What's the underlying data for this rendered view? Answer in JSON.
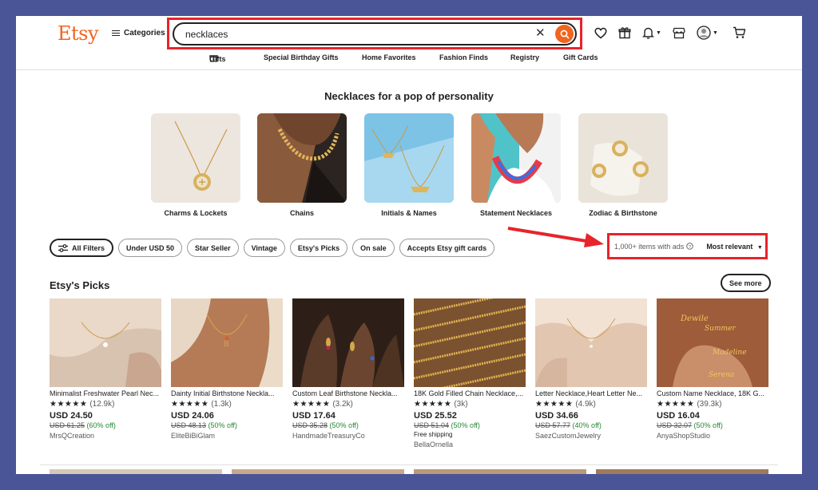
{
  "header": {
    "logo": "Etsy",
    "categories_label": "Categories",
    "search": {
      "value": "necklaces"
    }
  },
  "subnav": [
    "Gifts",
    "Special Birthday Gifts",
    "Home Favorites",
    "Fashion Finds",
    "Registry",
    "Gift Cards"
  ],
  "featured": {
    "title": "Necklaces for a pop of personality",
    "items": [
      {
        "label": "Charms & Lockets"
      },
      {
        "label": "Chains"
      },
      {
        "label": "Initials & Names"
      },
      {
        "label": "Statement Necklaces"
      },
      {
        "label": "Zodiac & Birthstone"
      }
    ]
  },
  "filters": [
    "All Filters",
    "Under USD 50",
    "Star Seller",
    "Vintage",
    "Etsy's Picks",
    "On sale",
    "Accepts Etsy gift cards"
  ],
  "results": {
    "count": "1,000+ items with ads",
    "sort": "Most relevant"
  },
  "picks": {
    "title": "Etsy's Picks",
    "see_more": "See more",
    "products": [
      {
        "title": "Minimalist Freshwater Pearl Nec...",
        "stars": "★★★★★",
        "reviews": "(12.9k)",
        "price": "USD 24.50",
        "original": "USD 61.25",
        "discount": "(60% off)",
        "shipping": "",
        "shop": "MrsQCreation"
      },
      {
        "title": "Dainty Initial Birthstone Neckla...",
        "stars": "★★★★★",
        "reviews": "(1.3k)",
        "price": "USD 24.06",
        "original": "USD 48.13",
        "discount": "(50% off)",
        "shipping": "",
        "shop": "EliteBiBiGlam"
      },
      {
        "title": "Custom Leaf Birthstone Neckla...",
        "stars": "★★★★★",
        "reviews": "(3.2k)",
        "price": "USD 17.64",
        "original": "USD 35.28",
        "discount": "(50% off)",
        "shipping": "",
        "shop": "HandmadeTreasuryCo"
      },
      {
        "title": "18K Gold Filled Chain Necklace,...",
        "stars": "★★★★★",
        "reviews": "(3k)",
        "price": "USD 25.52",
        "original": "USD 51.04",
        "discount": "(50% off)",
        "shipping": "Free shipping",
        "shop": "BellaOrnella"
      },
      {
        "title": "Letter Necklace,Heart Letter Ne...",
        "stars": "★★★★★",
        "reviews": "(4.9k)",
        "price": "USD 34.66",
        "original": "USD 57.77",
        "discount": "(40% off)",
        "shipping": "",
        "shop": "SaezCustomJewelry"
      },
      {
        "title": "Custom Name Necklace, 18K G...",
        "stars": "★★★★★",
        "reviews": "(39.3k)",
        "price": "USD 16.04",
        "original": "USD 32.07",
        "discount": "(50% off)",
        "shipping": "",
        "shop": "AnyaShopStudio"
      }
    ]
  },
  "colors": {
    "brand": "#f1641e",
    "highlight": "#e8232b",
    "discount": "#258635",
    "frame": "#4a5598"
  },
  "icons": [
    "search-icon",
    "clear-icon",
    "heart-icon",
    "gift-icon",
    "bell-icon",
    "store-icon",
    "user-avatar-icon",
    "cart-icon",
    "filter-icon",
    "info-icon"
  ]
}
